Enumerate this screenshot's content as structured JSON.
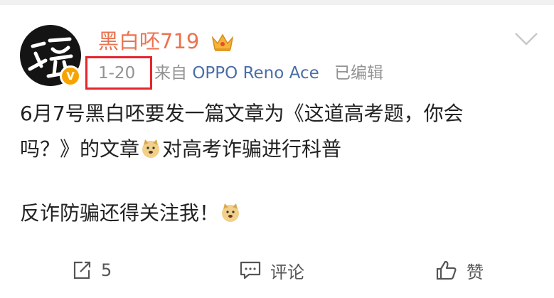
{
  "post": {
    "username": "黑白呸719",
    "timestamp": "1-20",
    "source_prefix": "来自",
    "source_device": "OPPO Reno Ace",
    "edited_label": "已编辑",
    "text_line1": "6月7号黑白呸要发一篇文章为《这道高考题，你会",
    "text_line2_part1": "吗？》的文章",
    "text_line2_part2": "对高考诈骗进行科普",
    "text_line3": "反诈防骗还得关注我！"
  },
  "avatar": {
    "verified_glyph": "V"
  },
  "icons": {
    "crown": "crown-icon",
    "chevron": "chevron-down-icon",
    "repost": "repost-icon",
    "comment": "comment-icon",
    "like": "thumbs-up-icon",
    "doge": "doge-emoji-icon"
  },
  "actions": {
    "repost_count": "5",
    "comment_label": "评论",
    "like_label": "赞"
  },
  "colors": {
    "username": "#eb7350",
    "device_link": "#4a6ea8",
    "highlight_box": "#e4262c",
    "verified_badge": "#f7a400"
  }
}
